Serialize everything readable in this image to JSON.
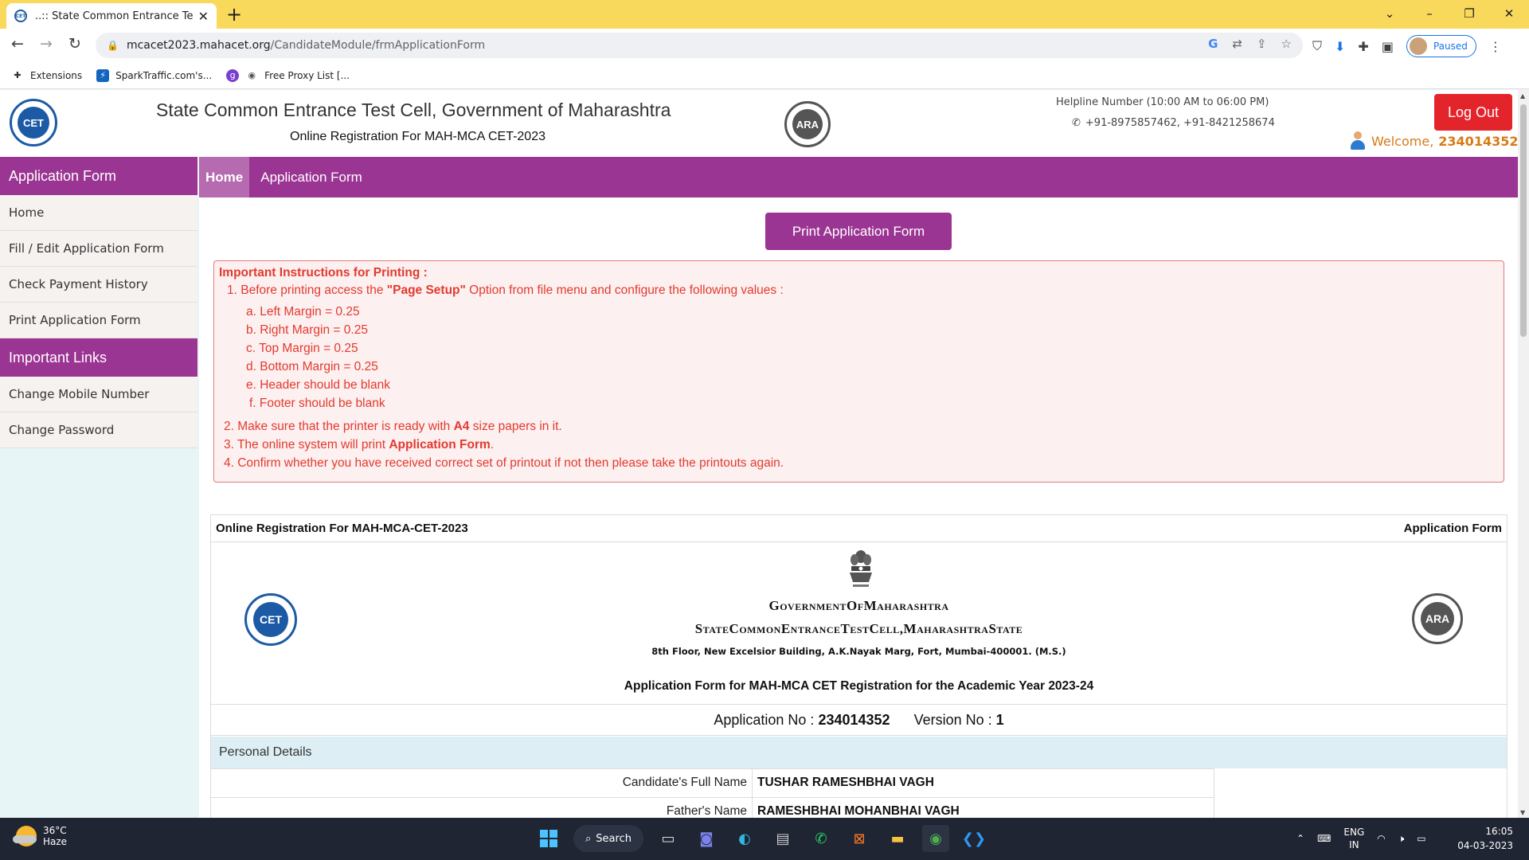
{
  "browser": {
    "tab_title": "..:: State Common Entrance Test C",
    "url_host": "mcacet2023.mahacet.org",
    "url_path": "/CandidateModule/frmApplicationForm",
    "profile_status": "Paused",
    "bookmarks": [
      "Extensions",
      "SparkTraffic.com's...",
      "Free Proxy List [..."
    ]
  },
  "header": {
    "title": "State Common Entrance Test Cell, Government of Maharashtra",
    "subtitle": "Online Registration For MAH-MCA CET-2023",
    "cet_logo_text": "CET",
    "ara_logo_text": "ARA",
    "helpline_label": "Helpline Number (10:00 AM to 06:00 PM)",
    "helpline_numbers": "+91-8975857462, +91-8421258674",
    "logout_label": "Log Out",
    "welcome_label": "Welcome,",
    "welcome_id": "234014352"
  },
  "sidebar": {
    "section1_title": "Application Form",
    "section1_items": [
      "Home",
      "Fill / Edit Application Form",
      "Check Payment History",
      "Print Application Form"
    ],
    "section2_title": "Important Links",
    "section2_items": [
      "Change Mobile Number",
      "Change Password"
    ]
  },
  "topmenu": {
    "items": [
      "Home",
      "Application Form"
    ]
  },
  "main": {
    "print_button": "Print Application Form",
    "instructions": {
      "heading": "Important Instructions for Printing :",
      "l1_pre": "1. Before printing access the ",
      "l1_bold": "\"Page Setup\"",
      "l1_post": " Option from file menu and configure the following values :",
      "sub": [
        "a. Left Margin = 0.25",
        "b. Right Margin = 0.25",
        "c. Top Margin = 0.25",
        "d. Bottom Margin = 0.25",
        "e. Header should be blank",
        "f. Footer should be blank"
      ],
      "l2_pre": "2. Make sure that the printer is ready with ",
      "l2_bold": "A4",
      "l2_post": " size papers in it.",
      "l3_pre": "3. The online system will print ",
      "l3_bold": "Application Form",
      "l3_post": ".",
      "l4": "4. Confirm whether you have received correct set of printout if not then please take the printouts again."
    },
    "form": {
      "top_left": "Online Registration For MAH-MCA-CET-2023",
      "top_right": "Application Form",
      "gov_line1": "GovernmentOfMaharashtra",
      "gov_line2": "StateCommonEntranceTestCell,MaharashtraState",
      "address": "8th Floor, New Excelsior Building, A.K.Nayak Marg, Fort, Mumbai-400001. (M.S.)",
      "form_title": "Application Form for MAH-MCA CET Registration for the Academic Year 2023-24",
      "app_no_label": "Application No :",
      "app_no": "234014352",
      "version_label": "Version No :",
      "version": "1",
      "section_title": "Personal Details",
      "rows": [
        {
          "label": "Candidate's Full Name",
          "value": "TUSHAR RAMESHBHAI VAGH"
        },
        {
          "label": "Father's Name",
          "value": "RAMESHBHAI MOHANBHAI VAGH"
        }
      ]
    }
  },
  "taskbar": {
    "temperature": "36°C",
    "weather": "Haze",
    "search_label": "Search",
    "lang1": "ENG",
    "lang2": "IN",
    "time": "16:05",
    "date": "04-03-2023"
  },
  "colors": {
    "tabbar": "#f8d95b",
    "purple": "#9b3593",
    "logout": "#e3242b",
    "instruction_text": "#e23a2e",
    "welcome": "#d87a14"
  }
}
